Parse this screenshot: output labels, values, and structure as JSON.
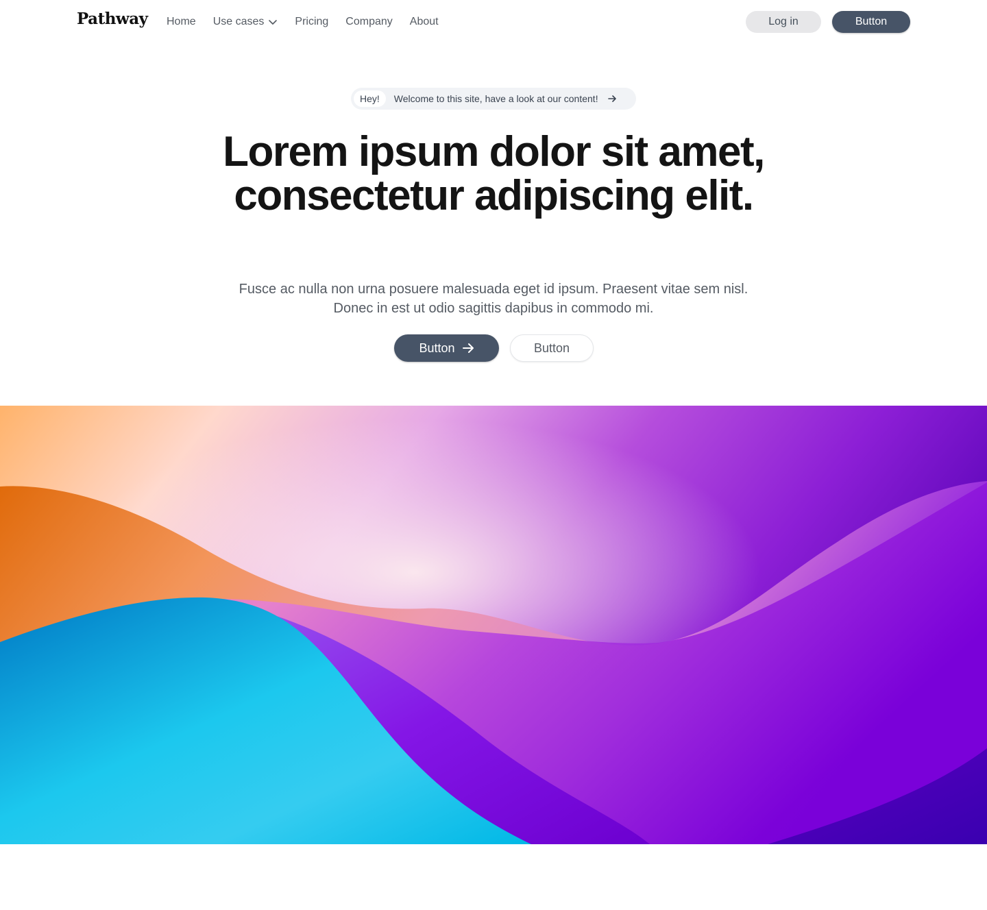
{
  "brand": {
    "name": "Pathway"
  },
  "nav": {
    "links": [
      {
        "label": "Home"
      },
      {
        "label": "Use cases",
        "has_dropdown": true
      },
      {
        "label": "Pricing"
      },
      {
        "label": "Company"
      },
      {
        "label": "About"
      }
    ],
    "login_label": "Log in",
    "primary_label": "Button"
  },
  "announcement": {
    "badge": "Hey!",
    "text": "Welcome to this site, have a look at our content!",
    "icon": "arrow-right-icon"
  },
  "hero": {
    "title": "Lorem ipsum dolor sit amet, consectetur adipiscing elit.",
    "subtitle": "Fusce ac nulla non urna posuere malesuada eget id ipsum. Praesent vitae sem nisl. Donec in est ut odio sagittis dapibus in commodo mi.",
    "primary_button": "Button",
    "secondary_button": "Button"
  },
  "colors": {
    "button_primary": "#475467",
    "button_login_bg": "#e7e7e9",
    "text_muted": "#555b63",
    "gradient_orange": "#f08a2c",
    "gradient_cyan": "#08b9e6",
    "gradient_purple": "#8a0fe0"
  }
}
